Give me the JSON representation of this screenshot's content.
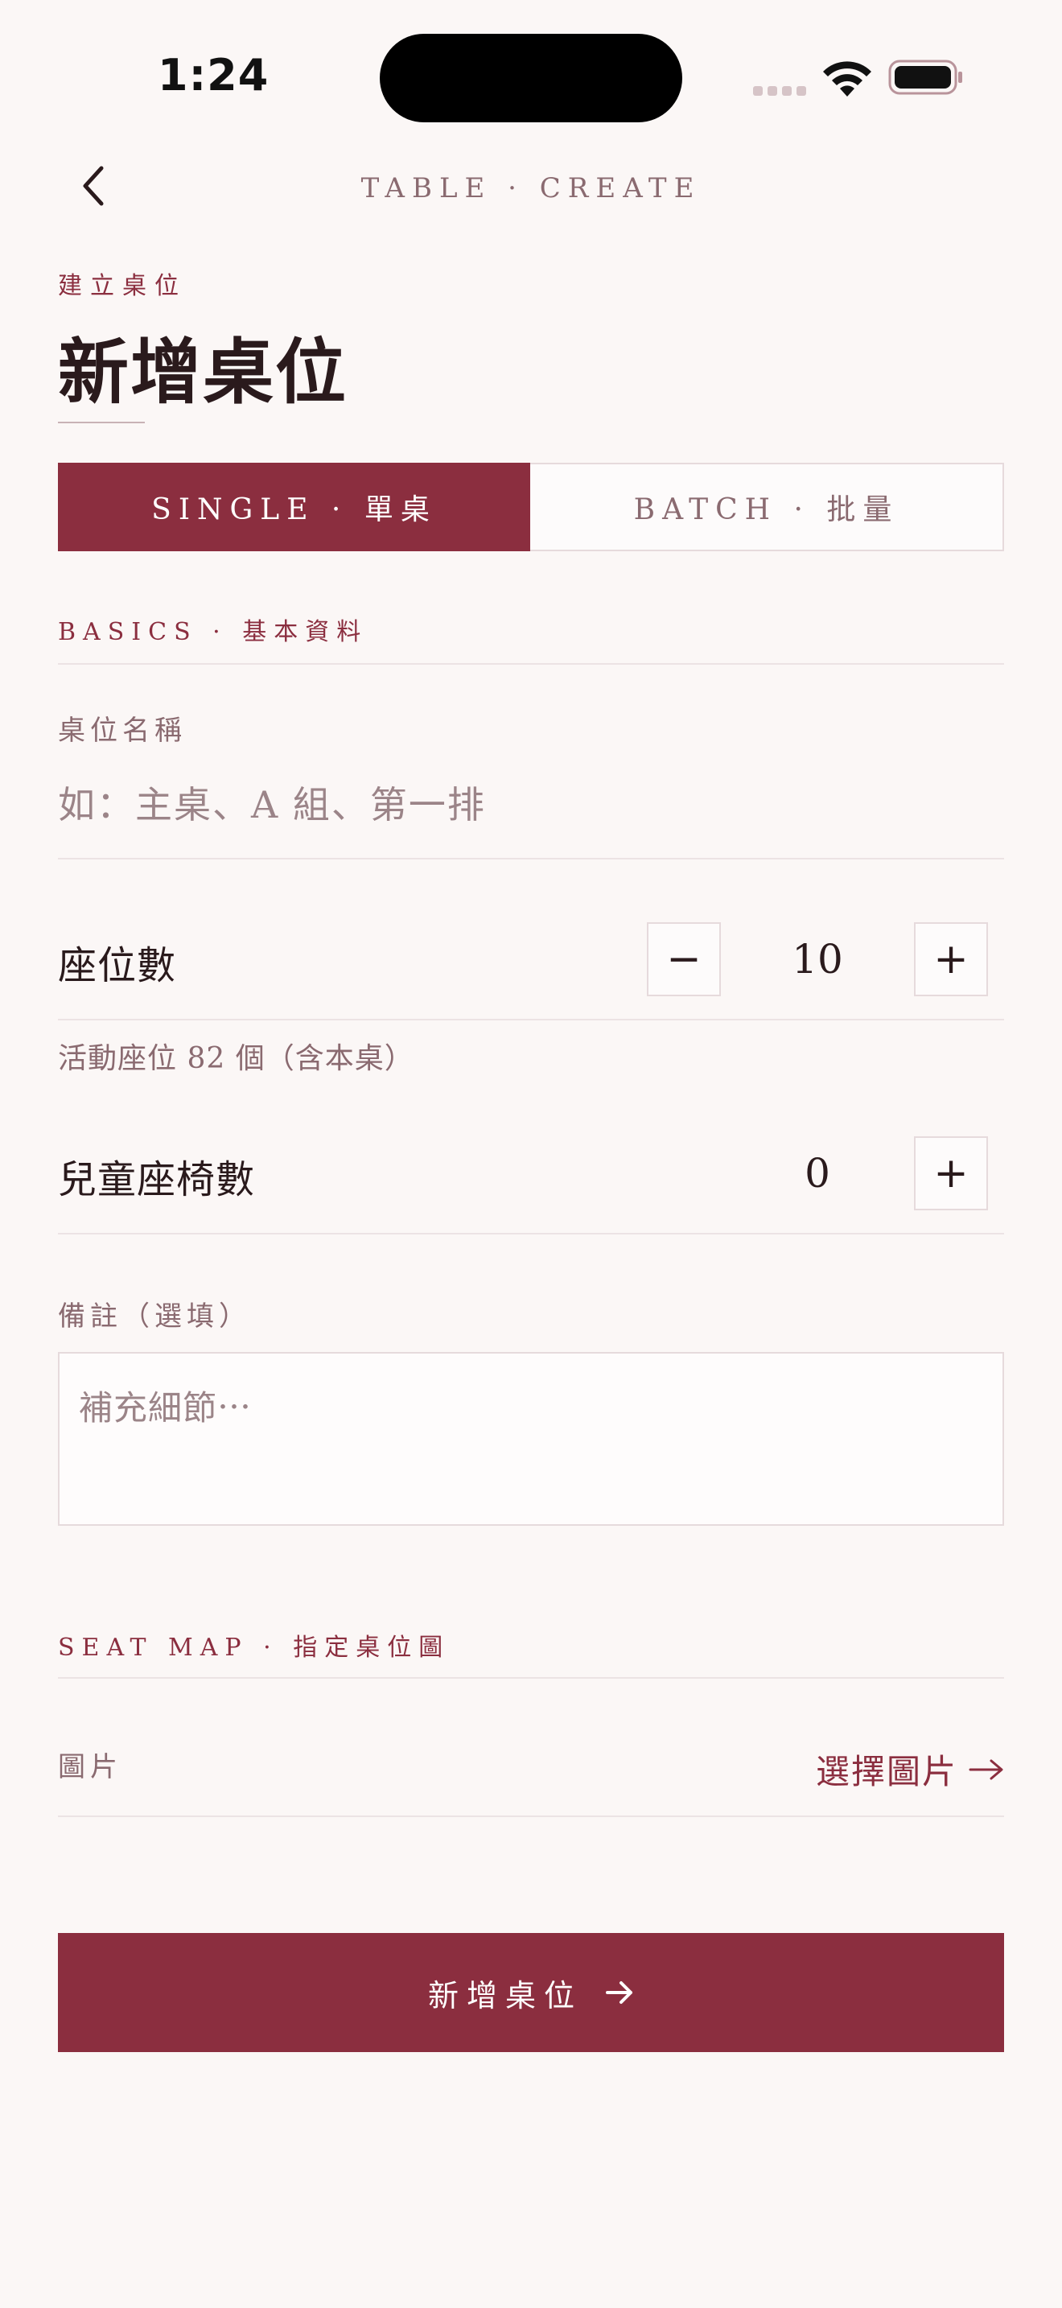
{
  "status_bar": {
    "time": "1:24"
  },
  "nav": {
    "title": "TABLE · CREATE"
  },
  "header": {
    "eyebrow": "建立桌位",
    "title": "新增桌位"
  },
  "segment": {
    "single_label": "SINGLE · 單桌",
    "batch_label": "BATCH · 批量",
    "active": "single"
  },
  "basics": {
    "section_label": "BASICS · 基本資料",
    "name_label": "桌位名稱",
    "name_placeholder": "如：主桌、A 組、第一排",
    "name_value": ""
  },
  "seats": {
    "label": "座位數",
    "value": "10",
    "decrement": "−",
    "increment": "+",
    "hint": "活動座位 82 個（含本桌）"
  },
  "child_seats": {
    "label": "兒童座椅數",
    "value": "0",
    "increment": "+"
  },
  "notes": {
    "label": "備註（選填）",
    "placeholder": "補充細節⋯",
    "value": ""
  },
  "seat_map": {
    "section_label": "SEAT MAP · 指定桌位圖",
    "image_label": "圖片",
    "choose_label": "選擇圖片"
  },
  "submit": {
    "label": "新增桌位"
  },
  "colors": {
    "accent": "#8b2e3f",
    "background": "#fbf7f6",
    "muted_text": "#8a6a70",
    "border": "#e6dadc"
  },
  "icons": {
    "back": "chevron-left-icon",
    "arrow": "arrow-right-icon",
    "wifi": "wifi-icon",
    "battery": "battery-icon"
  }
}
